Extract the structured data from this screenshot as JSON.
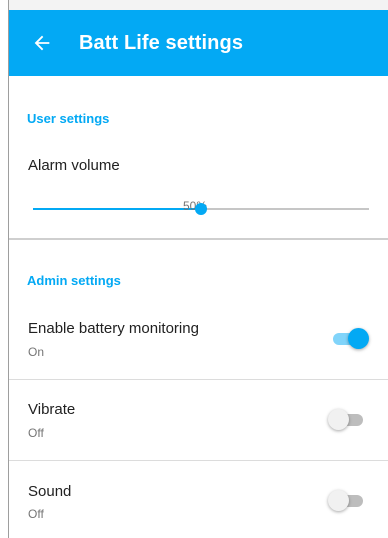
{
  "app_bar": {
    "title": "Batt Life settings",
    "back_icon": "arrow-left-icon",
    "color": "#03a9f4"
  },
  "user_settings": {
    "header": "User settings",
    "alarm_volume": {
      "label": "Alarm volume",
      "value_text": "50%",
      "value": 0.5
    }
  },
  "admin_settings": {
    "header": "Admin settings",
    "items": [
      {
        "label": "Enable battery monitoring",
        "status": "On",
        "checked": true
      },
      {
        "label": "Vibrate",
        "status": "Off",
        "checked": false
      },
      {
        "label": "Sound",
        "status": "Off",
        "checked": false
      }
    ]
  },
  "accent_color": "#03a9f4"
}
